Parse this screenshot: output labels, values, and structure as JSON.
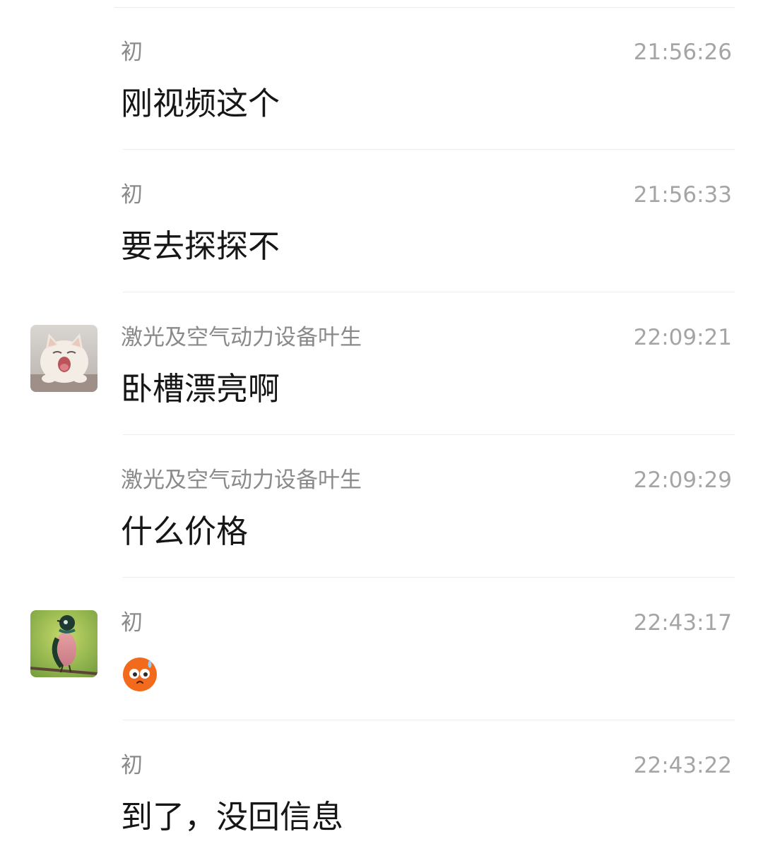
{
  "messages": [
    {
      "sender": "初",
      "time": "21:56:26",
      "text": "刚视频这个",
      "avatar": null
    },
    {
      "sender": "初",
      "time": "21:56:33",
      "text": "要去探探不",
      "avatar": null
    },
    {
      "sender": "激光及空气动力设备叶生",
      "time": "22:09:21",
      "text": "卧槽漂亮啊",
      "avatar": "cat-yawning-avatar"
    },
    {
      "sender": "激光及空气动力设备叶生",
      "time": "22:09:29",
      "text": "什么价格",
      "avatar": null
    },
    {
      "sender": "初",
      "time": "22:43:17",
      "text": "",
      "emoji": "sweat-face-emoji",
      "avatar": "bird-avatar"
    },
    {
      "sender": "初",
      "time": "22:43:22",
      "text": "到了，没回信息",
      "avatar": null
    }
  ],
  "colors": {
    "background": "#ffffff",
    "sender_text": "#8a8a8a",
    "time_text": "#a5a5a5",
    "message_text": "#161616",
    "divider": "#ececec",
    "emoji_orange": "#f36a1d"
  }
}
